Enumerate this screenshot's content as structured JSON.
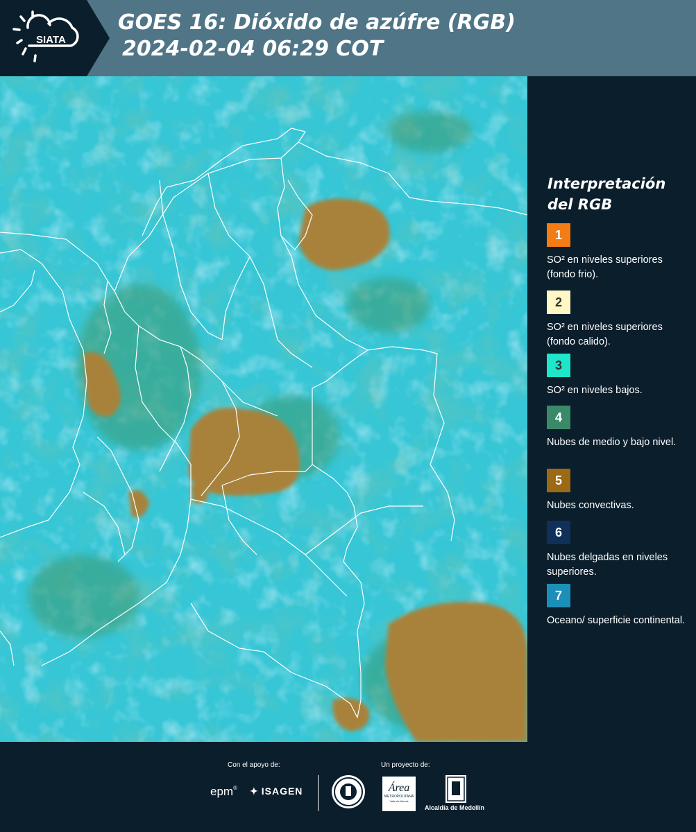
{
  "header": {
    "logo_text": "SIATA",
    "title_line1": "GOES 16: Dióxido de azúfre (RGB)",
    "title_line2": "2024-02-04 06:29 COT"
  },
  "legend": {
    "title": "Interpretación del RGB",
    "items": [
      {
        "num": "1",
        "color": "#f47c14",
        "num_color": "#ffffff",
        "text": "SO² en niveles superiores (fondo frio)."
      },
      {
        "num": "2",
        "color": "#fff7c4",
        "num_color": "#333333",
        "text": "SO² en niveles superiores (fondo calido)."
      },
      {
        "num": "3",
        "color": "#1de7c8",
        "num_color": "#333333",
        "text": "SO² en niveles bajos."
      },
      {
        "num": "4",
        "color": "#3a8a6a",
        "num_color": "#ffffff",
        "text": "Nubes de medio y bajo nivel."
      },
      {
        "num": "5",
        "color": "#9c6a14",
        "num_color": "#ffffff",
        "text": "Nubes convectivas."
      },
      {
        "num": "6",
        "color": "#10305a",
        "num_color": "#ffffff",
        "text": "Nubes delgadas en niveles superiores."
      },
      {
        "num": "7",
        "color": "#1c8fb8",
        "num_color": "#ffffff",
        "text": "Oceano/ superficie continental."
      }
    ]
  },
  "footer": {
    "support_label": "Con el apoyo de:",
    "project_label": "Un proyecto de:",
    "sponsor_epm": "epm",
    "sponsor_isagen": "ISAGEN",
    "sponsor_area": "Área",
    "sponsor_area_sub": "METROPOLITANA",
    "sponsor_area_sub2": "Valle de Aburrá",
    "sponsor_alcaldia": "Alcaldía de Medellín"
  },
  "map": {
    "colors": {
      "background": "#36c6d6",
      "convective": "#a8823a",
      "midlow": "#3a9a72",
      "borders": "#ffffff"
    }
  }
}
